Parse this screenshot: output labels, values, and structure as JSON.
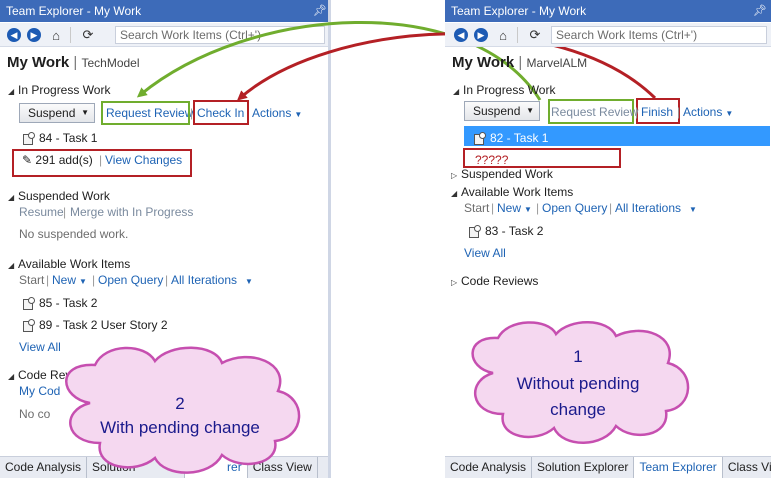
{
  "left": {
    "title": "Team Explorer - My Work",
    "search_placeholder": "Search Work Items (Ctrl+')",
    "heading": "My Work",
    "project": "TechModel",
    "in_progress": {
      "header": "In Progress Work",
      "suspend_label": "Suspend",
      "request_review": "Request Review",
      "check_in": "Check In",
      "actions": "Actions",
      "task": "84 - Task 1",
      "changes": "291 add(s)",
      "view_changes": "View Changes"
    },
    "suspended": {
      "header": "Suspended Work",
      "resume": "Resume",
      "merge": "Merge with In Progress",
      "empty": "No suspended work."
    },
    "available": {
      "header": "Available Work Items",
      "start": "Start",
      "new": "New",
      "open_query": "Open Query",
      "all_iterations": "All Iterations",
      "items": [
        "85 - Task 2",
        "89 - Task 2 User Story 2"
      ],
      "view_all": "View All"
    },
    "code_reviews": {
      "header": "Code Revie",
      "my_code": "My Cod",
      "empty": "No co"
    },
    "status_tabs": [
      "Code Analysis",
      "Solution",
      "rer",
      "Class View"
    ]
  },
  "right": {
    "title": "Team Explorer - My Work",
    "search_placeholder": "Search Work Items (Ctrl+')",
    "heading": "My Work",
    "project": "MarvelALM",
    "in_progress": {
      "header": "In Progress Work",
      "suspend_label": "Suspend",
      "request_review": "Request Review",
      "finish": "Finish",
      "actions": "Actions",
      "task": "82 - Task 1",
      "unknown": "?????"
    },
    "suspended": {
      "header": "Suspended Work"
    },
    "available": {
      "header": "Available Work Items",
      "start": "Start",
      "new": "New",
      "open_query": "Open Query",
      "all_iterations": "All Iterations",
      "items": [
        "83 - Task 2"
      ],
      "view_all": "View All"
    },
    "code_reviews": {
      "header": "Code Reviews"
    },
    "status_tabs": [
      "Code Analysis",
      "Solution Explorer",
      "Team Explorer",
      "Class View"
    ],
    "active_tab": "Team Explorer"
  },
  "callouts": {
    "left": {
      "number": "2",
      "text": "With pending change"
    },
    "right": {
      "number": "1",
      "line1": "Without pending",
      "line2": "change"
    }
  },
  "colors": {
    "title_bar": "#3d6bb9",
    "link": "#1e63b4",
    "selection": "#3399ff",
    "highlight_red": "#b42025",
    "highlight_green": "#70ad2e",
    "callout_fill": "#f5d8f0",
    "callout_border": "#c64fb0",
    "callout_text": "#1a1a8c"
  },
  "icons": [
    "back-icon",
    "forward-icon",
    "home-icon",
    "refresh-icon",
    "pin-icon",
    "task-icon",
    "pencil-icon",
    "collapse-triangle-icon",
    "expand-triangle-icon"
  ]
}
